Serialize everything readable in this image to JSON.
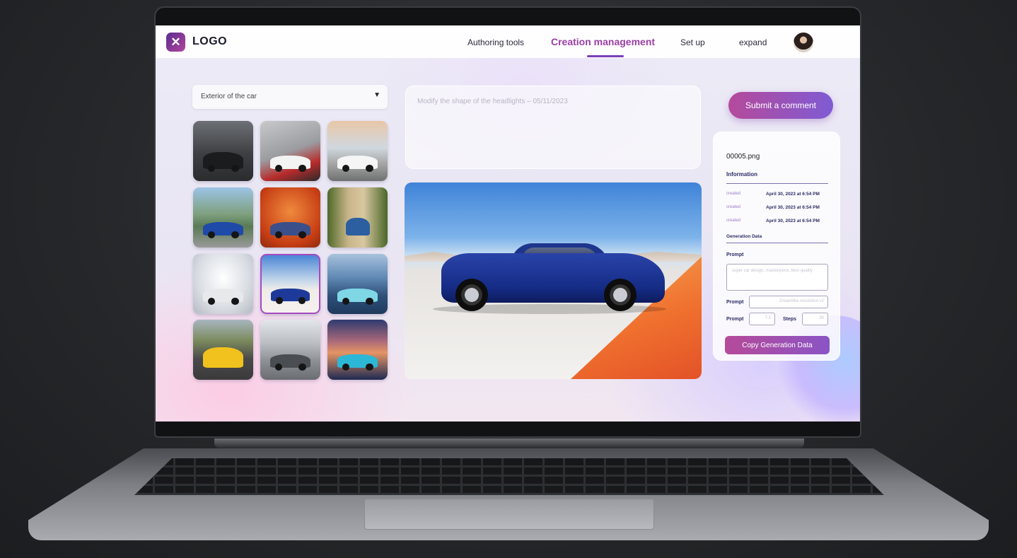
{
  "header": {
    "logo_text": "LOGO",
    "nav": [
      "Authoring tools",
      "Creation management",
      "Set up",
      "expand"
    ],
    "active_nav": "Creation management"
  },
  "category_select": {
    "value": "Exterior of the car"
  },
  "gallery": {
    "selected_index": 7,
    "count": 12
  },
  "comment": {
    "placeholder": "Modify the shape of the headlights – 05/11/2023"
  },
  "submit_button": "Submit a comment",
  "info_panel": {
    "filename": "00005.png",
    "information_title": "Information",
    "metadata": [
      {
        "key": "created",
        "value": "April 30, 2023 at 6:54 PM"
      },
      {
        "key": "created",
        "value": "April 30, 2023 at 6:54 PM"
      },
      {
        "key": "created",
        "value": "April 30, 2023 at 6:54 PM"
      }
    ],
    "generation_title": "Generation Data",
    "prompt_label": "Prompt",
    "prompt_text": "super car design, masterpiece, best quality",
    "prompt2_label": "Prompt",
    "prompt2_value": "Dreamlike resolution v2",
    "prompt3_label": "Prompt",
    "prompt3_value": "7.5",
    "steps_label": "Steps",
    "steps_value": "30",
    "copy_button": "Copy Generation Data"
  }
}
